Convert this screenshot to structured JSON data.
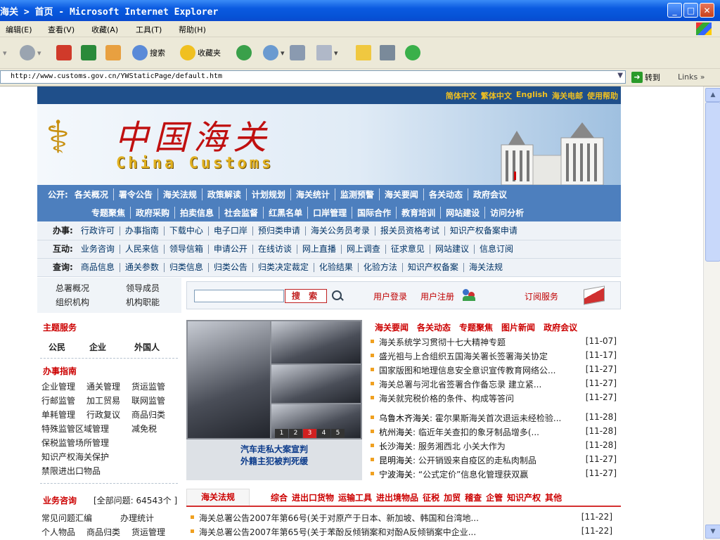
{
  "window": {
    "title": "海关 > 首页 - Microsoft Internet Explorer"
  },
  "menu": [
    "编辑(E)",
    "查看(V)",
    "收藏(A)",
    "工具(T)",
    "帮助(H)"
  ],
  "toolbar": {
    "search": "搜索",
    "favorites": "收藏夹"
  },
  "address": {
    "url": "http://www.customs.gov.cn/YWStaticPage/default.htm",
    "go": "转到",
    "links": "Links"
  },
  "site": {
    "top_links": [
      "简体中文",
      "繁体中文",
      "English",
      "海关电邮",
      "使用帮助"
    ],
    "banner": {
      "cn": "中国海关",
      "en": "China Customs"
    },
    "nav_public": {
      "lead": "公开:",
      "row1": [
        "各关概况",
        "署令公告",
        "海关法规",
        "政策解读",
        "计划规划",
        "海关统计",
        "监测预警",
        "海关要闻",
        "各关动态",
        "政府会议"
      ],
      "row2": [
        "专题聚焦",
        "政府采购",
        "拍卖信息",
        "社会监督",
        "红黑名单",
        "口岸管理",
        "国际合作",
        "教育培训",
        "网站建设",
        "访问分析"
      ]
    },
    "nav_work": {
      "lead": "办事:",
      "items": [
        "行政许可",
        "办事指南",
        "下载中心",
        "电子口岸",
        "预归类申请",
        "海关公务员考录",
        "报关员资格考试",
        "知识产权备案申请"
      ]
    },
    "nav_interact": {
      "lead": "互动:",
      "items": [
        "业务咨询",
        "人民来信",
        "领导信箱",
        "申请公开",
        "在线访谈",
        "网上直播",
        "网上调查",
        "征求意见",
        "网站建议",
        "信息订阅"
      ]
    },
    "nav_query": {
      "lead": "查询:",
      "items": [
        "商品信息",
        "通关参数",
        "归类信息",
        "归类公告",
        "归类决定裁定",
        "化验结果",
        "化验方法",
        "知识产权备案",
        "海关法规"
      ]
    },
    "sidebar": {
      "top": [
        "总署概况",
        "领导成员",
        "组织机构",
        "机构职能"
      ],
      "theme_title": "主题服务",
      "theme_items": [
        "公民",
        "企业",
        "外国人"
      ],
      "guide_title": "办事指南",
      "guide_items": [
        "企业管理",
        "通关管理",
        "货运监管",
        "行邮监管",
        "加工贸易",
        "联网监管",
        "单耗管理",
        "行政复议",
        "商品归类",
        "特殊监管区域管理",
        "减免税",
        "保税监管场所管理",
        "知识产权海关保护",
        "禁限进出口物品"
      ],
      "consult_title": "业务咨询",
      "consult_count": "[全部问题: 64543个 ]",
      "consult_items": [
        "常见问题汇编",
        "办理统计",
        "个人物品",
        "商品归类",
        "货运管理"
      ]
    },
    "search": {
      "button": "搜 索",
      "login": "用户登录",
      "register": "用户注册",
      "subscribe": "订阅服务"
    },
    "photo": {
      "caption1": "汽车走私大案宣判",
      "caption2": "外籍主犯被判死缓",
      "pages": [
        "1",
        "2",
        "3",
        "4",
        "5"
      ]
    },
    "news_tabs": [
      "海关要闻",
      "各关动态",
      "专题聚焦",
      "图片新闻",
      "政府会议"
    ],
    "news": [
      {
        "title": "海关系统学习贯彻十七大精神专题",
        "date": "[11-07]"
      },
      {
        "title": "盛光祖与上合组织五国海关署长签署海关协定",
        "date": "[11-17]"
      },
      {
        "title": "国家版图和地理信息安全意识宣传教育网络公...",
        "date": "[11-27]"
      },
      {
        "title": "海关总署与河北省签署合作备忘录 建立紧...",
        "date": "[11-27]"
      },
      {
        "title": "海关就完税价格的条件、构成等答问",
        "date": "[11-27]"
      },
      {
        "prefix": "乌鲁木齐海关",
        "title": ": 霍尔果斯海关首次退运未经检验...",
        "date": "[11-28]"
      },
      {
        "prefix": "杭州海关",
        "title": ": 临近年关查扣的象牙制品增多(...",
        "date": "[11-28]"
      },
      {
        "prefix": "长沙海关",
        "title": ": 服务湘西北 小关大作为",
        "date": "[11-28]"
      },
      {
        "prefix": "昆明海关",
        "title": ": 公开销毁来自疫区的走私肉制品",
        "date": "[11-27]"
      },
      {
        "prefix": "宁波海关",
        "title": ": “公式定价”信息化管理获双赢",
        "date": "[11-27]"
      }
    ],
    "reg_tab": "海关法规",
    "reg_cats": [
      "综合",
      "进出口货物",
      "运输工具",
      "进出境物品",
      "征税",
      "加贸",
      "稽查",
      "企管",
      "知识产权",
      "其他"
    ],
    "regs": [
      {
        "title": "海关总署公告2007年第66号(关于对原产于日本、新加坡、韩国和台湾地...",
        "date": "[11-22]"
      },
      {
        "title": "海关总署公告2007年第65号(关于苯酚反倾销案和对酚A反倾销案中企业...",
        "date": "[11-22]"
      }
    ]
  }
}
